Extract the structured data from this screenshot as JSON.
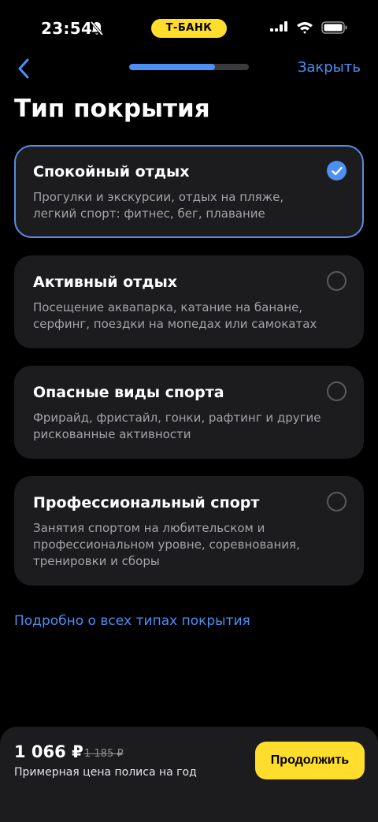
{
  "status_bar": {
    "time": "23:54",
    "carrier": "Т-БАНК"
  },
  "nav": {
    "close_label": "Закрыть",
    "progress": 0.72
  },
  "page_title": "Тип покрытия",
  "options": [
    {
      "title": "Спокойный отдых",
      "description": "Прогулки и экскурсии, отдых на пляже, легкий спорт: фитнес, бег, плавание",
      "selected": true
    },
    {
      "title": "Активный отдых",
      "description": "Посещение аквапарка, катание на банане, серфинг, поездки на мопедах или самокатах",
      "selected": false
    },
    {
      "title": "Опасные виды спорта",
      "description": "Фрирайд, фристайл, гонки, рафтинг и другие рискованные активности",
      "selected": false
    },
    {
      "title": "Профессиональный спорт",
      "description": "Занятия спортом на любительском и профессиональном уровне, соревнования, тренировки и сборы",
      "selected": false
    }
  ],
  "info_link": "Подробно о всех типах покрытия",
  "bottom": {
    "price": "1 066 ₽",
    "old_price": "1 185 ₽",
    "caption": "Примерная цена полиса на год",
    "continue_label": "Продолжить"
  },
  "colors": {
    "accent": "#4d8ff3",
    "brand_yellow": "#ffdd2d",
    "card": "#1c1c1e"
  }
}
